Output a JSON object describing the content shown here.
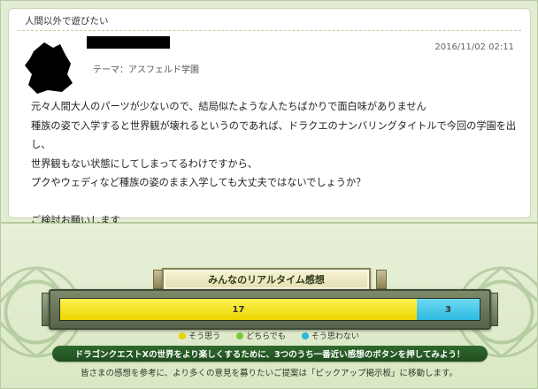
{
  "post": {
    "title": "人間以外で遊びたい",
    "theme": "テーマ：アスフェルド学園",
    "date": "2016/11/02 02:11",
    "lines": [
      "元々人間大人のパーツが少ないので、結局似たような人たちばかりで面白味がありません",
      "種族の姿で入学すると世界観が壊れるというのであれば、ドラクエのナンバリングタイトルで今回の学園を出し、",
      "世界観もない状態にしてしまってるわけですから、",
      "プクやウェディなど種族の姿のまま入学しても大丈夫ではないでしょうか？",
      "",
      "ご検討お願いします"
    ]
  },
  "reaction": {
    "header": "みんなのリアルタイム感想",
    "segments": [
      {
        "key": "yes",
        "count": 17,
        "label": "17"
      },
      {
        "key": "either",
        "count": 0,
        "label": ""
      },
      {
        "key": "no",
        "count": 3,
        "label": "3"
      }
    ],
    "legend": [
      {
        "key": "yes",
        "label": "そう思う",
        "color": "#e8d200"
      },
      {
        "key": "either",
        "label": "どちらでも",
        "color": "#80c832"
      },
      {
        "key": "no",
        "label": "そう思わない",
        "color": "#2fb6dc"
      }
    ],
    "banner": "ドラゴンクエストXの世界をより楽しくするために、3つのうち一番近い感想のボタンを押してみよう！",
    "info": "皆さまの感想を参考に、より多くの意見を募りたいご提案は「ピックアップ掲示板」に移動します。"
  }
}
